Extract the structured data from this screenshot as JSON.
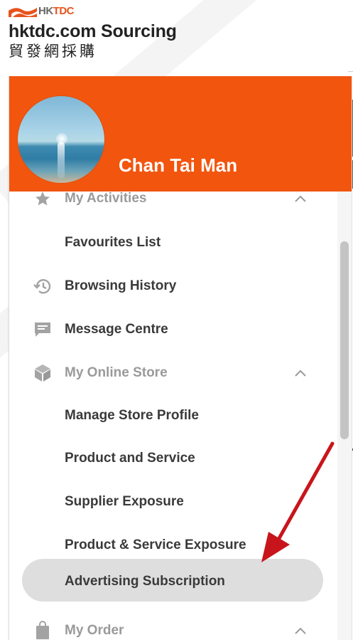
{
  "brand": {
    "logo_prefix": "HK",
    "logo_suffix": "TDC",
    "title": "hktdc.com Sourcing",
    "subtitle_cn": "貿發網採購"
  },
  "user": {
    "name": "Chan Tai Man"
  },
  "menu": {
    "my_activities": "My Activities",
    "favourites_list": "Favourites List",
    "browsing_history": "Browsing History",
    "message_centre": "Message Centre",
    "my_online_store": "My Online Store",
    "manage_store_profile": "Manage Store Profile",
    "product_and_service": "Product and Service",
    "supplier_exposure": "Supplier Exposure",
    "product_service_exposure": "Product & Service Exposure",
    "advertising_subscription": "Advertising Subscription",
    "my_order": "My Order"
  },
  "icons": {
    "my_activities": "star-icon",
    "browsing_history": "history-icon",
    "message_centre": "message-icon",
    "my_online_store": "box-icon",
    "my_order": "shopping-bag-icon"
  },
  "colors": {
    "header": "#f2550e",
    "selected": "#dedede",
    "annotation_arrow": "#c8151b"
  }
}
